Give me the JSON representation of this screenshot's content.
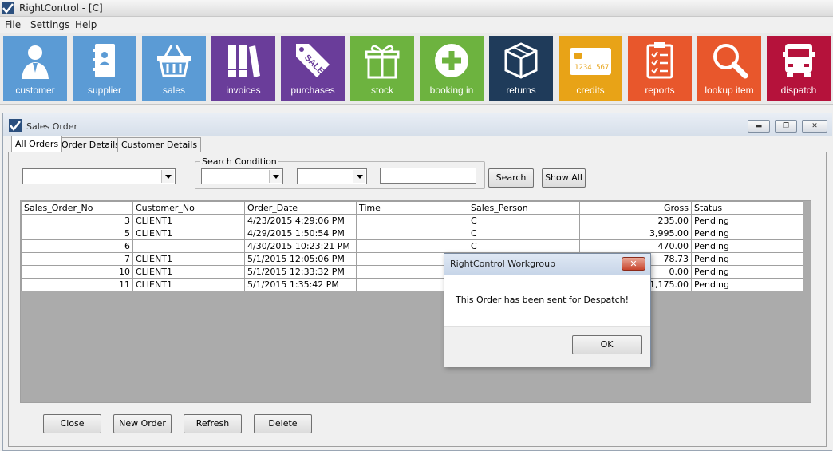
{
  "app": {
    "title": "RightControl - [C]"
  },
  "menu": [
    "File",
    "Settings",
    "Help"
  ],
  "toolbar": [
    {
      "label": "customer",
      "color": "#5b9bd5",
      "icon": "customer-icon"
    },
    {
      "label": "supplier",
      "color": "#5b9bd5",
      "icon": "supplier-icon"
    },
    {
      "label": "sales",
      "color": "#5b9bd5",
      "icon": "basket-icon"
    },
    {
      "label": "invoices",
      "color": "#6a3d9a",
      "icon": "books-icon"
    },
    {
      "label": "purchases",
      "color": "#6a3d9a",
      "icon": "sale-tag-icon"
    },
    {
      "label": "stock",
      "color": "#6db33f",
      "icon": "gift-icon"
    },
    {
      "label": "booking in",
      "color": "#6db33f",
      "icon": "plus-circle-icon"
    },
    {
      "label": "returns",
      "color": "#1f3b5a",
      "icon": "box-icon"
    },
    {
      "label": "credits",
      "color": "#e8a317",
      "icon": "credit-card-icon"
    },
    {
      "label": "reports",
      "color": "#e8572c",
      "icon": "clipboard-icon"
    },
    {
      "label": "lookup item",
      "color": "#e8572c",
      "icon": "magnifier-icon"
    },
    {
      "label": "dispatch",
      "color": "#b5123b",
      "icon": "truck-icon"
    }
  ],
  "window": {
    "title": "Sales Order",
    "tabs": [
      "All Orders",
      "Order Details",
      "Customer Details"
    ],
    "search_condition_label": "Search Condition",
    "search_button": "Search",
    "show_all_button": "Show All",
    "columns": [
      "Sales_Order_No",
      "Customer_No",
      "Order_Date",
      "Time",
      "Sales_Person",
      "Gross",
      "Status"
    ],
    "rows": [
      [
        "3",
        "CLIENT1",
        "4/23/2015 4:29:06 PM",
        "",
        "C",
        "235.00",
        "Pending"
      ],
      [
        "5",
        "CLIENT1",
        "4/29/2015 1:50:54 PM",
        "",
        "C",
        "3,995.00",
        "Pending"
      ],
      [
        "6",
        "",
        "4/30/2015 10:23:21 PM",
        "",
        "C",
        "470.00",
        "Pending"
      ],
      [
        "7",
        "CLIENT1",
        "5/1/2015 12:05:06 PM",
        "",
        "",
        "78.73",
        "Pending"
      ],
      [
        "10",
        "CLIENT1",
        "5/1/2015 12:33:32 PM",
        "",
        "",
        "0.00",
        "Pending"
      ],
      [
        "11",
        "CLIENT1",
        "5/1/2015 1:35:42 PM",
        "",
        "",
        "1,175.00",
        "Pending"
      ]
    ],
    "buttons": {
      "close": "Close",
      "new_order": "New Order",
      "refresh": "Refresh",
      "delete": "Delete"
    }
  },
  "dialog": {
    "title": "RightControl Workgroup",
    "message": "This Order has been sent for Despatch!",
    "ok": "OK"
  }
}
